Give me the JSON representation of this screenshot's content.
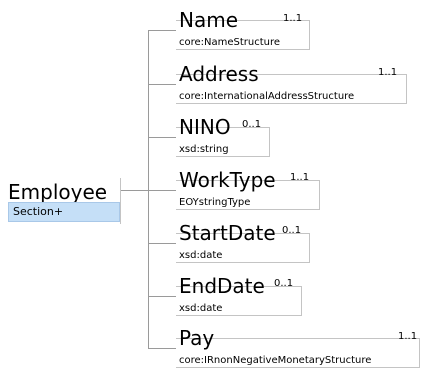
{
  "root": {
    "name": "Employee",
    "type": "Section+"
  },
  "children": [
    {
      "name": "Name",
      "type": "core:NameStructure",
      "cardinality": "1..1"
    },
    {
      "name": "Address",
      "type": "core:InternationalAddressStructure",
      "cardinality": "1..1"
    },
    {
      "name": "NINO",
      "type": "xsd:string",
      "cardinality": "0..1"
    },
    {
      "name": "WorkType",
      "type": "EOYstringType",
      "cardinality": "1..1"
    },
    {
      "name": "StartDate",
      "type": "xsd:date",
      "cardinality": "0..1"
    },
    {
      "name": "EndDate",
      "type": "xsd:date",
      "cardinality": "0..1"
    },
    {
      "name": "Pay",
      "type": "core:IRnonNegativeMonetaryStructure",
      "cardinality": "1..1"
    }
  ]
}
